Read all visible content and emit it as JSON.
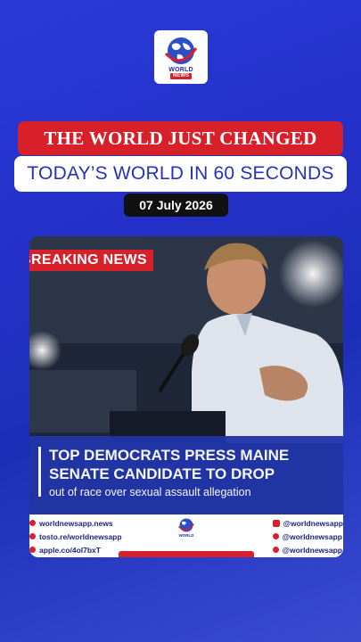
{
  "brand": {
    "logo_line1": "WORLD",
    "logo_line2": "NEWS"
  },
  "headline": "THE WORLD JUST CHANGED",
  "subheadline": "TODAY’S WORLD IN 60 SECONDS",
  "date": "07 July 2026",
  "story": {
    "badge": "BREAKING NEWS",
    "title": "TOP DEMOCRATS PRESS MAINE SENATE CANDIDATE TO DROP",
    "subtitle": "out of race over sexual assault allegation"
  },
  "footer": {
    "links_left": [
      "worldnewsapp.news",
      "tosto.re/worldnewsapp",
      "apple.co/4ol7bxT"
    ],
    "handles_right": [
      "@worldnewsapp",
      "@worldnewsapp",
      "@worldnewsapp"
    ]
  },
  "colors": {
    "accent_red": "#d8202a",
    "brand_blue": "#2632b8",
    "background_blue": "#2430c8"
  }
}
